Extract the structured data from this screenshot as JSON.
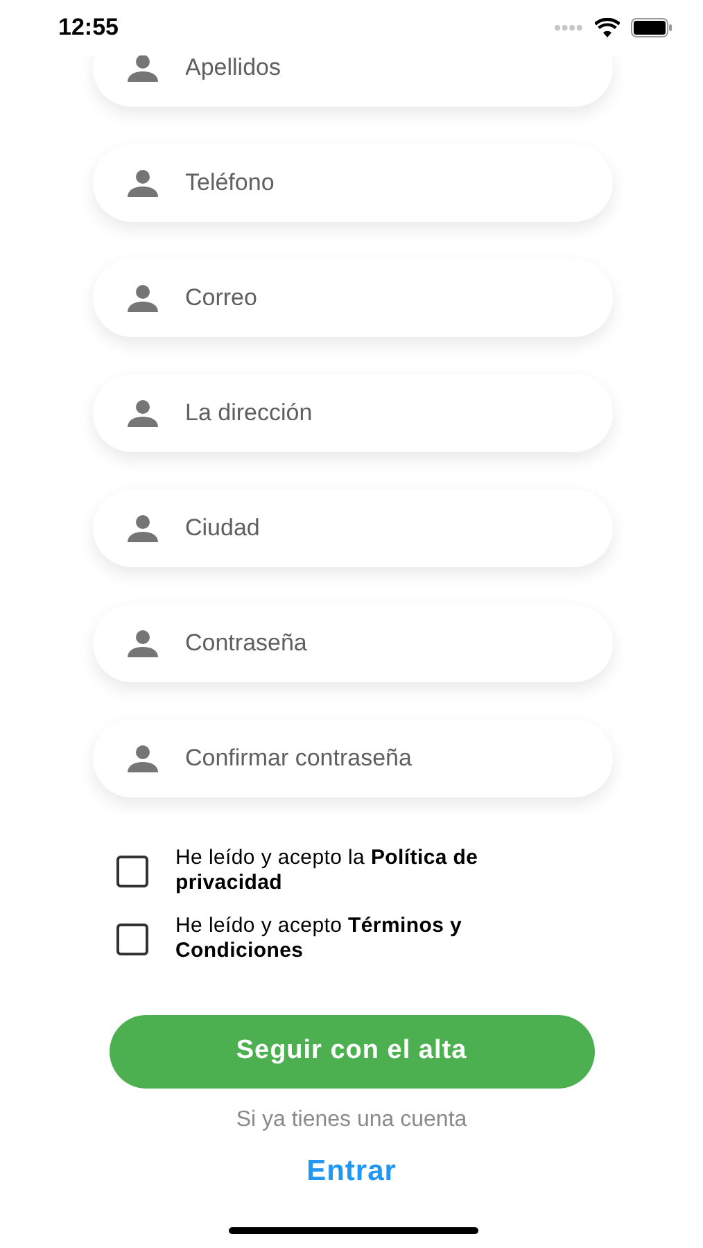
{
  "status_bar": {
    "time": "12:55"
  },
  "fields": [
    {
      "placeholder": "Apellidos"
    },
    {
      "placeholder": "Teléfono"
    },
    {
      "placeholder": "Correo"
    },
    {
      "placeholder": "La dirección"
    },
    {
      "placeholder": "Ciudad"
    },
    {
      "placeholder": "Contraseña"
    },
    {
      "placeholder": "Confirmar contraseña"
    }
  ],
  "agreements": [
    {
      "text": "He leído y acepto la **Política de privacidad**",
      "checked": false
    },
    {
      "text": "He leído y acepto **Términos y Condiciones**",
      "checked": false
    }
  ],
  "submit_button": "Seguir con el alta",
  "login_prompt": "Si ya tienes una cuenta",
  "login_link": "Entrar"
}
